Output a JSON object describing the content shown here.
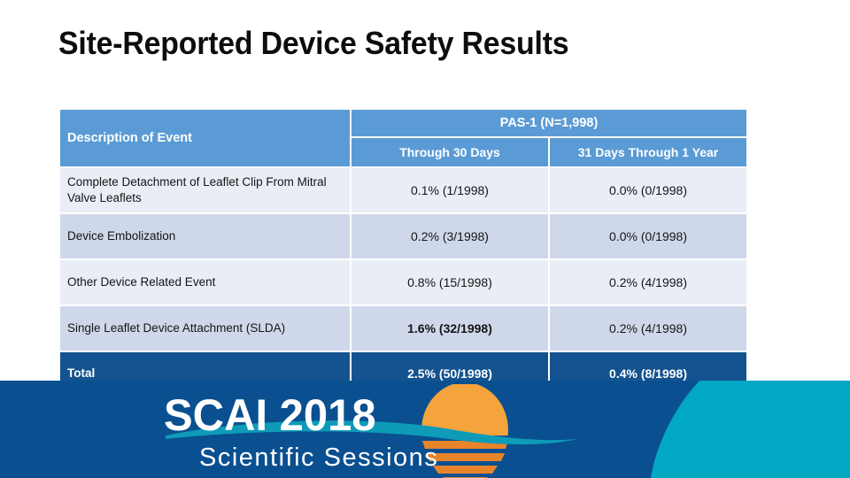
{
  "slide": {
    "title": "Site-Reported Device Safety Results"
  },
  "table": {
    "headers": {
      "description": "Description of Event",
      "group": "PAS-1 (N=1,998)",
      "col1": "Through 30 Days",
      "col2": "31 Days Through 1 Year"
    },
    "rows": [
      {
        "description": "Complete Detachment of Leaflet Clip From Mitral Valve Leaflets",
        "through_30_days": "0.1% (1/1998)",
        "days_31_through_1_year": "0.0% (0/1998)"
      },
      {
        "description": "Device Embolization",
        "through_30_days": "0.2% (3/1998)",
        "days_31_through_1_year": "0.0% (0/1998)"
      },
      {
        "description": "Other Device Related Event",
        "through_30_days": "0.8% (15/1998)",
        "days_31_through_1_year": "0.2% (4/1998)"
      },
      {
        "description": "Single Leaflet Device Attachment (SLDA)",
        "through_30_days": "1.6% (32/1998)",
        "days_31_through_1_year": "0.2% (4/1998)"
      }
    ],
    "total": {
      "description": "Total",
      "through_30_days": "2.5% (50/1998)",
      "days_31_through_1_year": "0.4% (8/1998)"
    }
  },
  "footer": {
    "logo_title": "SCAI 2018",
    "logo_subtitle": "Scientific Sessions"
  },
  "colors": {
    "header_blue": "#5B9BD5",
    "row_light": "#E9EDF5",
    "row_dark": "#CFD8EA",
    "total_blue": "#14538F",
    "footer_blue": "#0A5090",
    "footer_teal": "#00A8C4",
    "logo_orange": "#F5A33C",
    "logo_wave_teal": "#0E9BB8"
  }
}
